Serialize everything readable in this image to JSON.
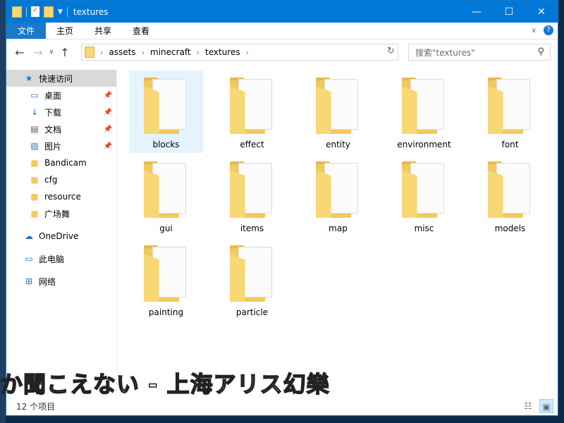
{
  "window": {
    "title": "textures"
  },
  "ribbon": {
    "tabs": [
      "文件",
      "主页",
      "共享",
      "查看"
    ]
  },
  "address": {
    "crumbs": [
      "assets",
      "minecraft",
      "textures"
    ],
    "search_placeholder": "搜索\"textures\""
  },
  "sidebar": {
    "items": [
      {
        "label": "快速访问",
        "icon": "star-icon",
        "pinned": false
      },
      {
        "label": "桌面",
        "icon": "desktop-icon",
        "pinned": true
      },
      {
        "label": "下载",
        "icon": "download-icon",
        "pinned": true
      },
      {
        "label": "文档",
        "icon": "document-icon",
        "pinned": true
      },
      {
        "label": "图片",
        "icon": "pictures-icon",
        "pinned": true
      },
      {
        "label": "Bandicam",
        "icon": "folder-icon",
        "pinned": false
      },
      {
        "label": "cfg",
        "icon": "folder-icon",
        "pinned": false
      },
      {
        "label": "resource",
        "icon": "folder-icon",
        "pinned": false
      },
      {
        "label": "广场舞",
        "icon": "folder-icon",
        "pinned": false
      },
      {
        "label": "OneDrive",
        "icon": "cloud-icon",
        "pinned": false
      },
      {
        "label": "此电脑",
        "icon": "computer-icon",
        "pinned": false
      },
      {
        "label": "网络",
        "icon": "network-icon",
        "pinned": false
      }
    ]
  },
  "folders": [
    "blocks",
    "effect",
    "entity",
    "environment",
    "font",
    "gui",
    "items",
    "map",
    "misc",
    "models",
    "painting",
    "particle"
  ],
  "overlay_text": "か聞こえない - 上海アリス幻樂",
  "status": {
    "count": "12 个项目"
  },
  "colors": {
    "accent": "#0078d7",
    "folder": "#f8d775"
  }
}
